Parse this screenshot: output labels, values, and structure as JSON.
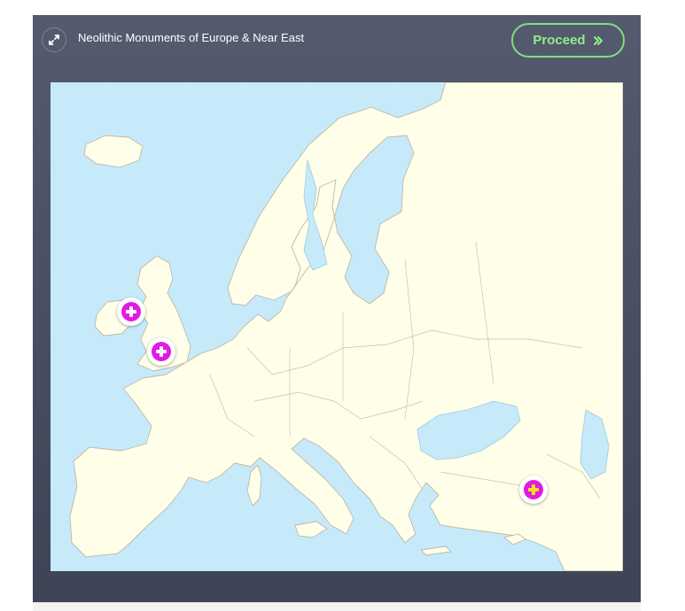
{
  "header": {
    "title": "Neolithic Monuments of Europe & Near East",
    "proceed_label": "Proceed",
    "expand_icon": "expand-icon",
    "proceed_icon": "double-chevron-right-icon"
  },
  "map": {
    "sea_color": "#c7eafb",
    "land_color": "#fefee9",
    "border_color": "#bdb8a8",
    "markers": [
      {
        "name": "map-marker-ireland",
        "icon": "plus-circle-icon"
      },
      {
        "name": "map-marker-britain",
        "icon": "plus-circle-icon"
      },
      {
        "name": "map-marker-anatolia",
        "icon": "plus-circle-icon"
      }
    ]
  },
  "colors": {
    "panel_bg": "#4c5064",
    "accent": "#8ff08a",
    "marker": "#e21be2"
  }
}
